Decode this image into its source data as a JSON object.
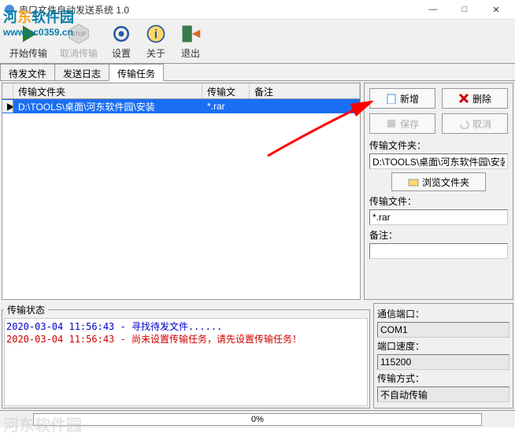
{
  "window": {
    "title": "串口文件自动发送系统 1.0",
    "min": "—",
    "max": "□",
    "close": "✕"
  },
  "watermark": {
    "text1a": "河",
    "text1b": "东",
    "text1c": "软件园",
    "url": "www.pc0359.cn",
    "bl": "河东软件园"
  },
  "toolbar": {
    "start": "开始传输",
    "cancel": "取消传输",
    "settings": "设置",
    "about": "关于",
    "exit": "退出"
  },
  "tabs": {
    "pending": "待发文件",
    "log": "发送日志",
    "tasks": "传输任务"
  },
  "table": {
    "col_folder": "传输文件夹",
    "col_file": "传输文件",
    "col_note": "备注",
    "rows": [
      {
        "marker": "▶",
        "folder": "D:\\TOOLS\\桌面\\河东软件园\\安装",
        "file": "*.rar",
        "note": ""
      }
    ]
  },
  "sidepanel": {
    "add": "新增",
    "delete": "删除",
    "save": "保存",
    "cancel": "取消",
    "folder_label": "传输文件夹：",
    "folder_value": "D:\\TOOLS\\桌面\\河东软件园\\安装",
    "browse": "浏览文件夹",
    "file_label": "传输文件：",
    "file_value": "*.rar",
    "note_label": "备注：",
    "note_value": ""
  },
  "status": {
    "legend": "传输状态",
    "lines": [
      {
        "cls": "log-blue",
        "text": "2020-03-04 11:56:43 - 寻找待发文件......"
      },
      {
        "cls": "log-red",
        "text": "2020-03-04 11:56:43 - 尚未设置传输任务，请先设置传输任务！"
      }
    ]
  },
  "comm": {
    "port_label": "通信端口：",
    "port_value": "COM1",
    "baud_label": "端口速度：",
    "baud_value": "115200",
    "mode_label": "传输方式：",
    "mode_value": "不自动传输"
  },
  "progress": "0%"
}
